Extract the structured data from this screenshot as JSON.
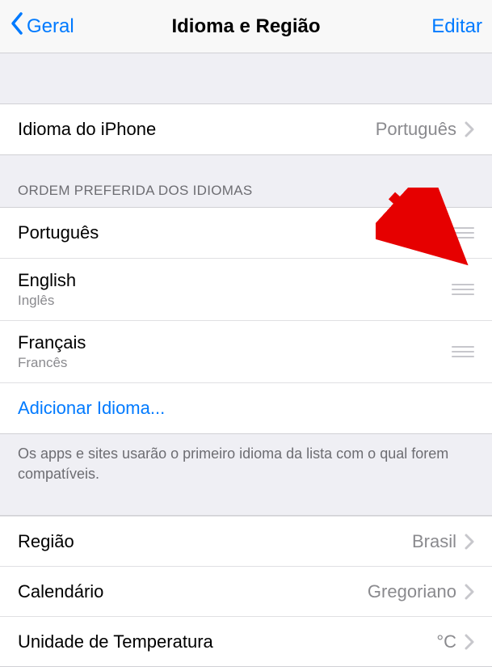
{
  "nav": {
    "back_label": "Geral",
    "title": "Idioma e Região",
    "edit_label": "Editar"
  },
  "iphone_language": {
    "label": "Idioma do iPhone",
    "value": "Português"
  },
  "preferred_languages": {
    "header": "ORDEM PREFERIDA DOS IDIOMAS",
    "items": [
      {
        "name": "Português",
        "sub": ""
      },
      {
        "name": "English",
        "sub": "Inglês"
      },
      {
        "name": "Français",
        "sub": "Francês"
      }
    ],
    "add_label": "Adicionar Idioma...",
    "footer": "Os apps e sites usarão o primeiro idioma da lista com o qual forem compatíveis."
  },
  "region_rows": [
    {
      "label": "Região",
      "value": "Brasil"
    },
    {
      "label": "Calendário",
      "value": "Gregoriano"
    },
    {
      "label": "Unidade de Temperatura",
      "value": "°C"
    }
  ]
}
